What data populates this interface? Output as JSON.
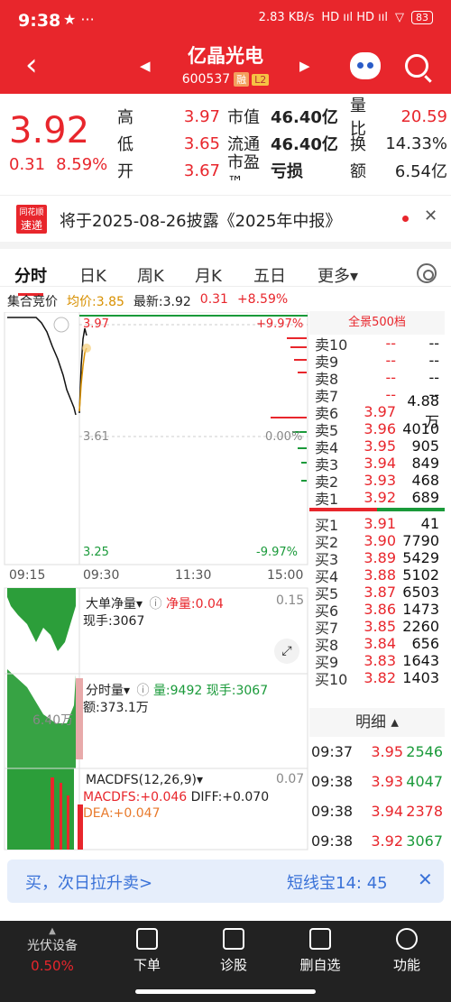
{
  "status": {
    "time": "9:38",
    "left_icons": "★ ···",
    "speed": "2.83 KB/s",
    "signal": "HD ııl HD ııl",
    "wifi": "▽",
    "battery": "83"
  },
  "header": {
    "title": "亿晶光电",
    "code": "600537",
    "tag1": "融",
    "tag2": "L2"
  },
  "quote": {
    "price": "3.92",
    "change": "0.31",
    "change_pct": "8.59%",
    "rows": [
      {
        "k1": "高",
        "v1": "3.97",
        "k2": "市值",
        "v2": "46.40亿",
        "k3": "量比",
        "v3": "20.59"
      },
      {
        "k1": "低",
        "v1": "3.65",
        "k2": "流通",
        "v2": "46.40亿",
        "k3": "换",
        "v3": "14.33%"
      },
      {
        "k1": "开",
        "v1": "3.67",
        "k2": "市盈™",
        "v2": "亏损",
        "k3": "额",
        "v3": "6.54亿"
      }
    ]
  },
  "news": {
    "badge_top": "同花顺",
    "badge_bottom": "速递",
    "text": "将于2025-08-26披露《2025年中报》"
  },
  "tabs": [
    "分时",
    "日K",
    "周K",
    "月K",
    "五日",
    "更多▾"
  ],
  "chart_legend": {
    "auction": "集合竞价",
    "avg": "均价:3.85",
    "latest": "最新:3.92",
    "chg": "0.31",
    "chg_pct": "+8.59%"
  },
  "price_axis": {
    "high": "3.97",
    "high_pct": "+9.97%",
    "mid": "3.61",
    "mid_pct": "0.00%",
    "low": "3.25",
    "low_pct": "-9.97%"
  },
  "time_axis": [
    "09:15",
    "09:30",
    "11:30",
    "15:00"
  ],
  "big_order": {
    "label": "大单净量▾",
    "net": "净量:0.04",
    "cur": "现手:3067",
    "right": "0.15"
  },
  "volume": {
    "label": "分时量▾",
    "vol": "量:9492",
    "cur": "现手:3067",
    "amt": "额:373.1万",
    "side": "6.40万"
  },
  "macd": {
    "label": "MACDFS(12,26,9)▾",
    "right": "0.07",
    "macdfs": "MACDFS:+0.046",
    "diff": "DIFF:+0.070",
    "dea": "DEA:+0.047"
  },
  "book": {
    "title": "全景500档",
    "sells": [
      {
        "lbl": "卖10",
        "p": "--",
        "v": "--"
      },
      {
        "lbl": "卖9",
        "p": "--",
        "v": "--"
      },
      {
        "lbl": "卖8",
        "p": "--",
        "v": "--"
      },
      {
        "lbl": "卖7",
        "p": "--",
        "v": "--"
      },
      {
        "lbl": "卖6",
        "p": "3.97",
        "v": "4.88万"
      },
      {
        "lbl": "卖5",
        "p": "3.96",
        "v": "4010"
      },
      {
        "lbl": "卖4",
        "p": "3.95",
        "v": "905"
      },
      {
        "lbl": "卖3",
        "p": "3.94",
        "v": "849"
      },
      {
        "lbl": "卖2",
        "p": "3.93",
        "v": "468"
      },
      {
        "lbl": "卖1",
        "p": "3.92",
        "v": "689"
      }
    ],
    "buys": [
      {
        "lbl": "买1",
        "p": "3.91",
        "v": "41"
      },
      {
        "lbl": "买2",
        "p": "3.90",
        "v": "7790"
      },
      {
        "lbl": "买3",
        "p": "3.89",
        "v": "5429"
      },
      {
        "lbl": "买4",
        "p": "3.88",
        "v": "5102"
      },
      {
        "lbl": "买5",
        "p": "3.87",
        "v": "6503"
      },
      {
        "lbl": "买6",
        "p": "3.86",
        "v": "1473"
      },
      {
        "lbl": "买7",
        "p": "3.85",
        "v": "2260"
      },
      {
        "lbl": "买8",
        "p": "3.84",
        "v": "656"
      },
      {
        "lbl": "买9",
        "p": "3.83",
        "v": "1643"
      },
      {
        "lbl": "买10",
        "p": "3.82",
        "v": "1403"
      }
    ]
  },
  "detail": {
    "title": "明细 ▴",
    "rows": [
      {
        "t": "09:37",
        "p": "3.95",
        "v": "2546",
        "vc": "#1a9a3a"
      },
      {
        "t": "09:38",
        "p": "3.93",
        "v": "4047",
        "vc": "#1a9a3a"
      },
      {
        "t": "09:38",
        "p": "3.94",
        "v": "2378",
        "vc": "#e8262c"
      },
      {
        "t": "09:38",
        "p": "3.92",
        "v": "3067",
        "vc": "#1a9a3a"
      }
    ]
  },
  "promo": {
    "left": "买，次日拉升卖>",
    "right": "短线宝14: 45"
  },
  "bottom": {
    "sector": "光伏设备",
    "sector_pct": "0.50%",
    "items": [
      "下单",
      "诊股",
      "删自选",
      "功能"
    ]
  },
  "colors": {
    "up": "#e8262c",
    "down": "#1a9a3a",
    "avg": "#d89000"
  }
}
